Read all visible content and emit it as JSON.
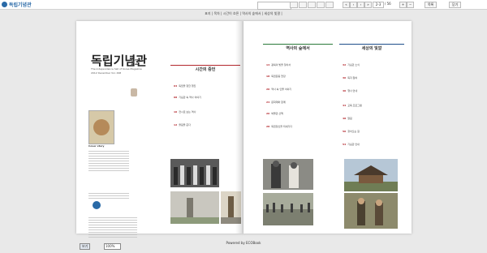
{
  "app": {
    "logo_text": "독립기념관"
  },
  "toolbar": {
    "search_placeholder": "",
    "page_current": "2-3",
    "page_total": "/ 56",
    "btn_list": "목록",
    "btn_close": "닫기"
  },
  "breadcrumb": "표지 | 목차 | 시간이 흐른 | 역사의 숲에서 | 세상의 빛깔 |",
  "left_page": {
    "title": "독립기념관",
    "subtitle": "The independence hall of Korea Magazine",
    "issue_line": "2012 December Vol. 298",
    "issue_number": "12",
    "cover_label": "Cover story"
  },
  "columns": [
    {
      "title": "시간의 증언",
      "accent": "#b3272d",
      "entries": [
        {
          "no": "04",
          "text": "독립을 향한 행진"
        },
        {
          "no": "08",
          "text": "기념관 속 역사 이야기"
        },
        {
          "no": "10",
          "text": "전시로 보는 역사"
        },
        {
          "no": "12",
          "text": "울림을 준다"
        }
      ]
    },
    {
      "title": "역사의 숲에서",
      "accent": "#2b7a3a",
      "entries": [
        {
          "no": "14",
          "text": "광복의 빛을 찾아서"
        },
        {
          "no": "18",
          "text": "독립운동 현장"
        },
        {
          "no": "20",
          "text": "역사 속 인물 이야기"
        },
        {
          "no": "24",
          "text": "문화재와 함께"
        },
        {
          "no": "26",
          "text": "박물관 산책"
        },
        {
          "no": "28",
          "text": "독립정신을 되새기다"
        }
      ]
    },
    {
      "title": "세상의 빛깔",
      "accent": "#1e4e8a",
      "entries": [
        {
          "no": "32",
          "text": "기념관 소식"
        },
        {
          "no": "36",
          "text": "독자 참여"
        },
        {
          "no": "40",
          "text": "행사 안내"
        },
        {
          "no": "44",
          "text": "교육 프로그램"
        },
        {
          "no": "48",
          "text": "알림"
        },
        {
          "no": "50",
          "text": "찾아오는 길"
        },
        {
          "no": "54",
          "text": "기념관 안내"
        }
      ]
    }
  ],
  "footer": "Powered by ECOBook",
  "zoom": {
    "label": "보기",
    "value": "100%"
  }
}
